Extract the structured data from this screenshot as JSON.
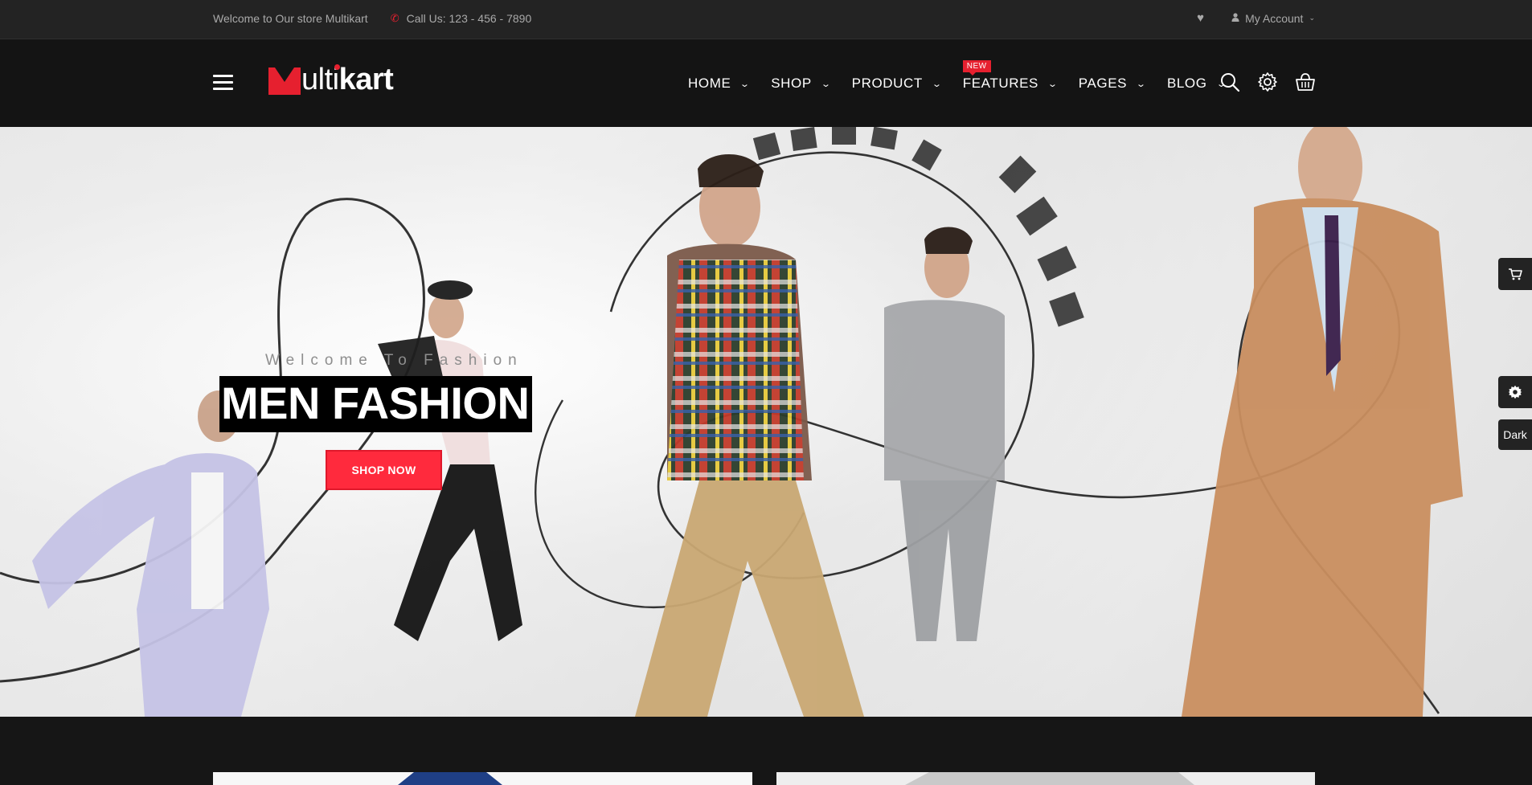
{
  "topbar": {
    "welcome": "Welcome to Our store Multikart",
    "phone": "Call Us: 123 - 456 - 7890",
    "account": "My Account"
  },
  "logo": {
    "thin": "ult",
    "bold": "kart",
    "i_char": "i"
  },
  "nav": {
    "items": [
      {
        "label": "HOME"
      },
      {
        "label": "SHOP"
      },
      {
        "label": "PRODUCT"
      },
      {
        "label": "FEATURES",
        "badge": "NEW"
      },
      {
        "label": "PAGES"
      },
      {
        "label": "BLOG"
      }
    ]
  },
  "hero": {
    "subtitle": "Welcome To Fashion",
    "title": "MEN FASHION",
    "button": "SHOP NOW"
  },
  "side": {
    "dark_label": "Dark"
  },
  "colors": {
    "accent": "#ff2a3d",
    "topbar_bg": "#232323",
    "header_bg": "#141414"
  },
  "icons": [
    "phone-icon",
    "heart-icon",
    "user-icon",
    "menu-icon",
    "search-icon",
    "gear-icon",
    "basket-icon",
    "cart-icon"
  ]
}
